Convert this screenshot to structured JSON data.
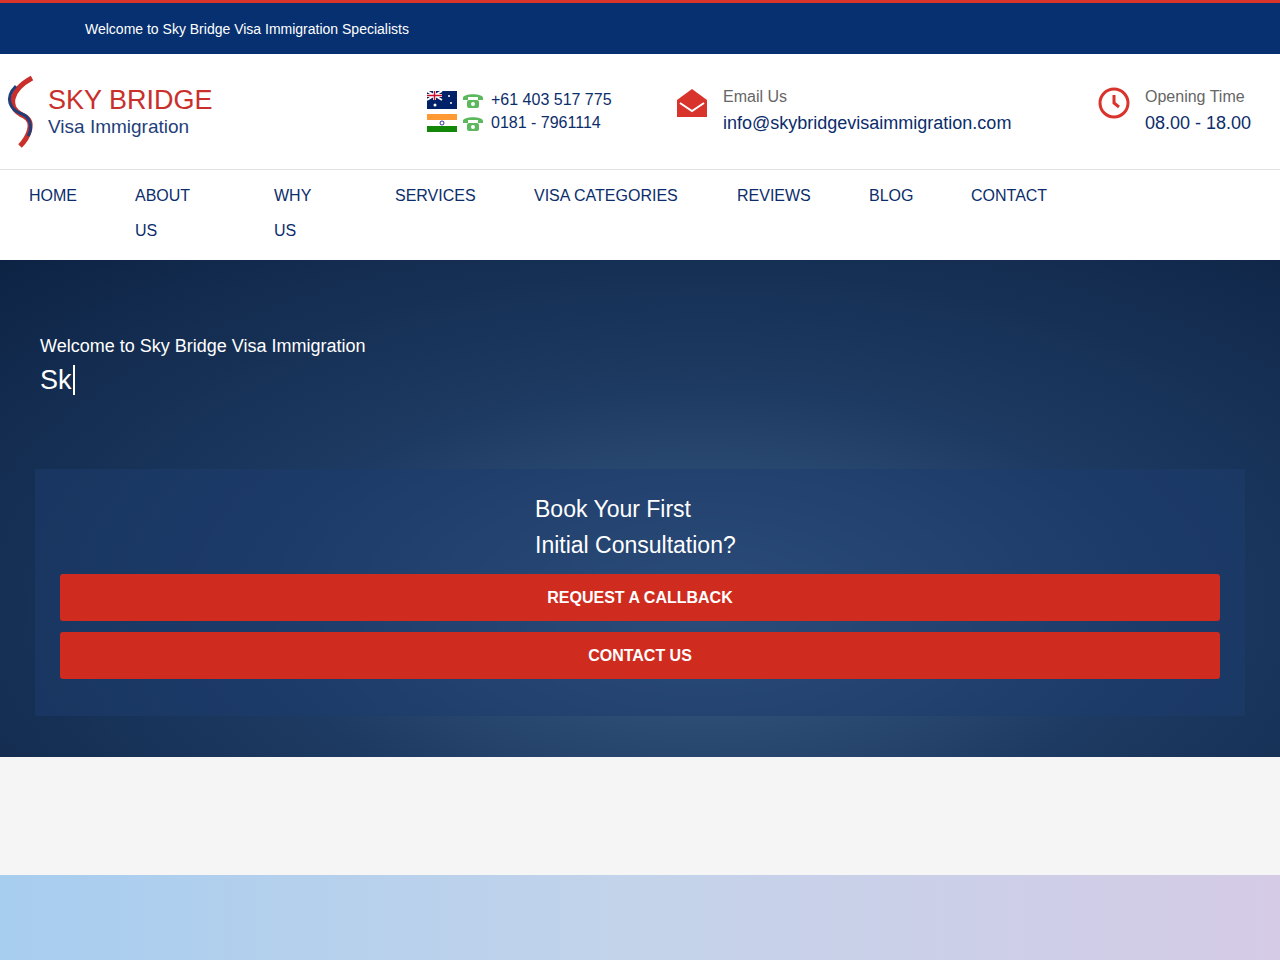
{
  "topbar": {
    "text": "Welcome to Sky Bridge Visa Immigration Specialists"
  },
  "logo": {
    "title": "SKY BRIDGE",
    "subtitle": "Visa Immigration"
  },
  "phones": [
    {
      "kind": "au",
      "number": "+61 403 517 775"
    },
    {
      "kind": "in",
      "number": "0181 - 7961114"
    }
  ],
  "email": {
    "label": "Email Us",
    "value": "info@skybridgevisaimmigration.com"
  },
  "hours": {
    "label": "Opening Time",
    "value": "08.00 - 18.00"
  },
  "nav": [
    "HOME",
    "ABOUT US",
    "WHY US",
    "SERVICES",
    "VISA CATEGORIES",
    "REVIEWS",
    "BLOG",
    "CONTACT"
  ],
  "hero": {
    "subtitle": "Welcome to Sky Bridge Visa Immigration",
    "typed": "Sk",
    "consult": [
      "Book Your First",
      "Initial Consultation?"
    ],
    "buttons": [
      "REQUEST A CALLBACK",
      "CONTACT US"
    ]
  }
}
